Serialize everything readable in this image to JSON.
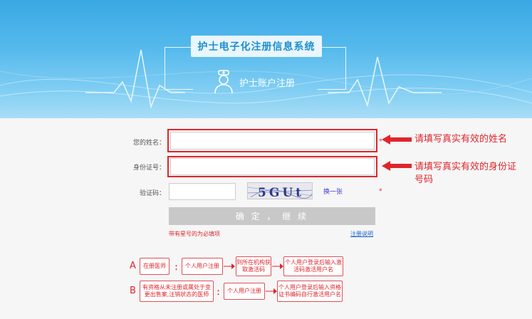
{
  "header": {
    "system_title": "护士电子化注册信息系统",
    "sub_title": "护士账户注册"
  },
  "form": {
    "name_label": "您的姓名：",
    "name_value": "",
    "id_label": "身份证号：",
    "id_value": "",
    "captcha_label": "验证码：",
    "captcha_value": "",
    "captcha_text": "5GUt",
    "refresh_label": "换一张",
    "required_mark": "*",
    "submit_label": "确 定 ， 继 续",
    "required_note": "带有星号的为必填项",
    "help_link": "注册说明"
  },
  "annotations": {
    "name_hint": "请填写真实有效的姓名",
    "id_hint_line1": "请填写真实有效的身份证",
    "id_hint_line2": "号码"
  },
  "flow": {
    "a": {
      "letter": "A",
      "who": "在册医师",
      "colon": "：",
      "steps": [
        "个人用户注册",
        "到所在机构获取激活码",
        "个人用户登录后输入激活码激活用户名"
      ]
    },
    "b": {
      "letter": "B",
      "who": "有资格从未注册或属处于变更出售案,注销状态的医师",
      "colon": "：",
      "steps": [
        "个人用户注册",
        "个人用户登录后输入资格证书编码自行激活用户名"
      ]
    }
  },
  "colors": {
    "accent_red": "#e0252b",
    "banner_blue": "#3aa8e4",
    "title_text": "#1e8fd0"
  }
}
